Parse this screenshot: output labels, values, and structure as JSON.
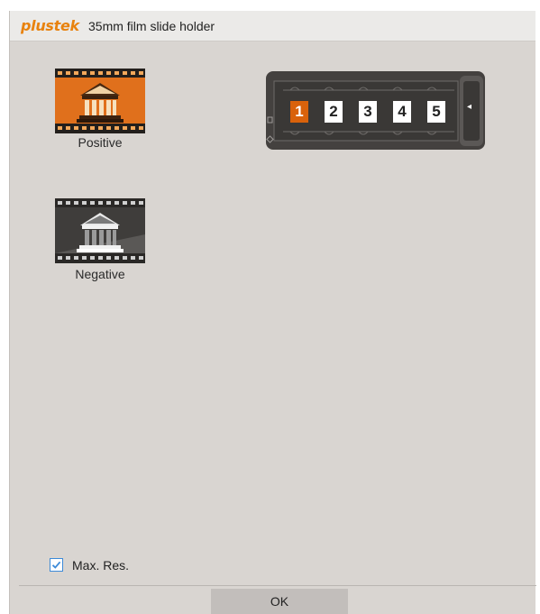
{
  "window": {
    "brand": "plustek",
    "title": "35mm film slide holder"
  },
  "film_types": [
    {
      "label": "Positive",
      "icon": "positive-film-icon",
      "selected": true
    },
    {
      "label": "Negative",
      "icon": "negative-film-icon",
      "selected": false
    }
  ],
  "slide_holder": {
    "frames": [
      "1",
      "2",
      "3",
      "4",
      "5"
    ],
    "selected_frame": "1",
    "eject_arrow": "◂"
  },
  "options": {
    "max_res_label": "Max. Res.",
    "max_res_checked": true
  },
  "footer": {
    "ok_label": "OK"
  },
  "colors": {
    "brand": "#e8820e",
    "accent": "#d9620b",
    "background": "#d9d5d1",
    "checkbox": "#3c8ad8"
  }
}
